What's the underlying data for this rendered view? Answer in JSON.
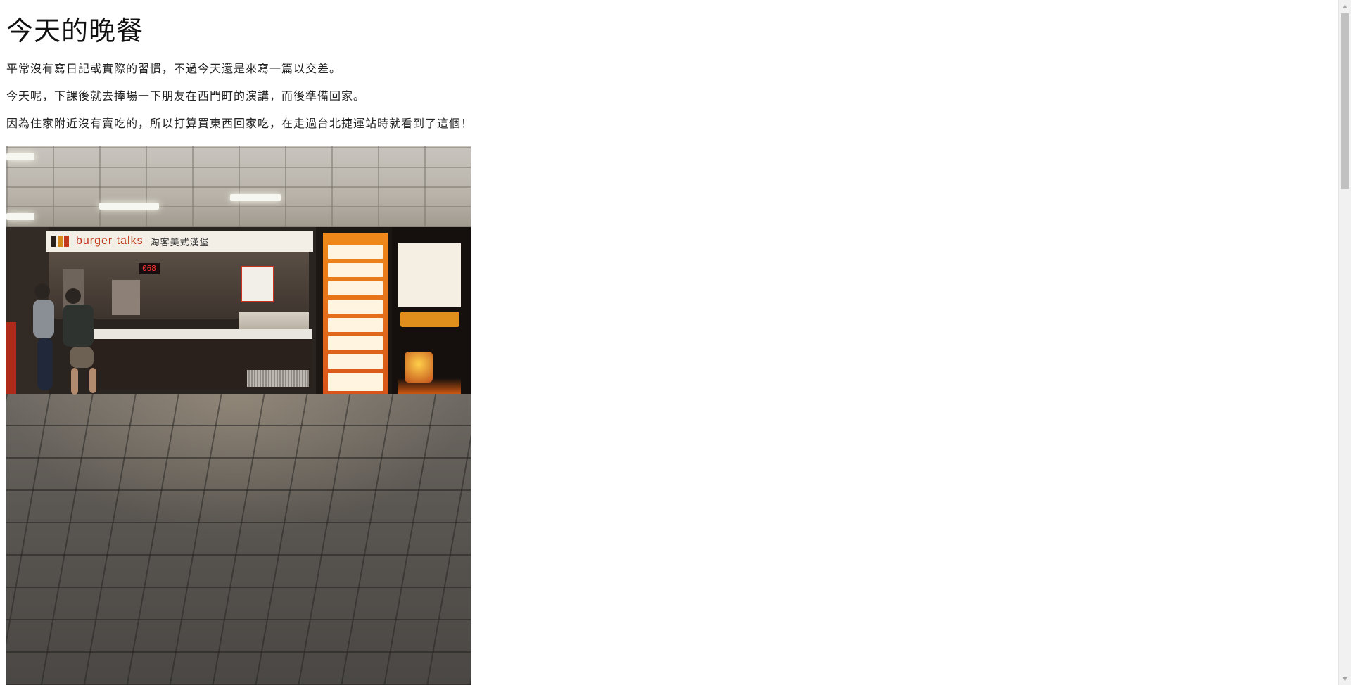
{
  "article": {
    "title": "今天的晚餐",
    "paragraphs": [
      "平常沒有寫日記或實際的習慣，不過今天還是來寫一篇以交差。",
      "今天呢，下課後就去捧場一下朋友在西門町的演講，而後準備回家。",
      "因為住家附近沒有賣吃的，所以打算買東西回家吃，在走過台北捷運站時就看到了這個！"
    ],
    "photo": {
      "store_sign_en": "burger talks",
      "store_sign_cn": "淘客美式漢堡",
      "queue_number": "068"
    }
  },
  "colors": {
    "brand_red": "#c23a1c",
    "menu_orange": "#e0731a",
    "background": "#ffffff",
    "text": "#222222"
  },
  "scrollbar": {
    "up_icon": "scroll-up-arrow-icon",
    "down_icon": "scroll-down-arrow-icon"
  }
}
